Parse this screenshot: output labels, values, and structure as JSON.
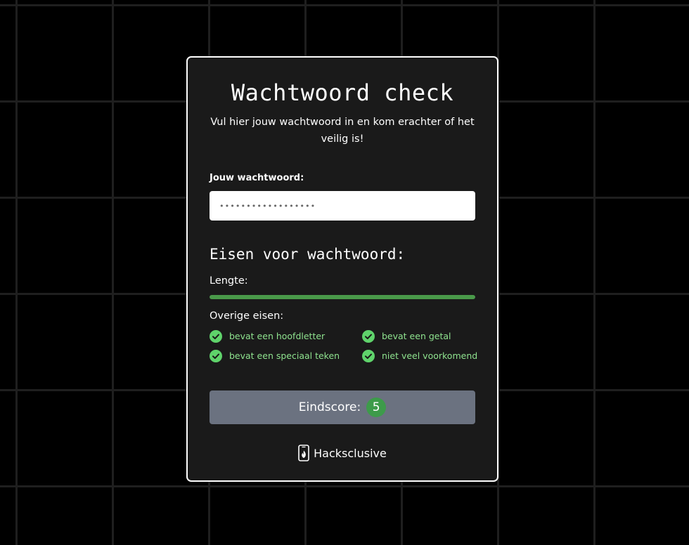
{
  "card": {
    "title": "Wachtwoord check",
    "subtitle": "Vul hier jouw wachtwoord in en kom erachter of het veilig is!"
  },
  "password": {
    "label": "Jouw wachtwoord:",
    "value": "••••••••••••••••••"
  },
  "requirements": {
    "title": "Eisen voor wachtwoord:",
    "length_label": "Lengte:",
    "length_progress": 1.0,
    "other_label": "Overige eisen:",
    "checks": [
      {
        "label": "bevat een hoofdletter",
        "met": true
      },
      {
        "label": "bevat een getal",
        "met": true
      },
      {
        "label": "bevat een speciaal teken",
        "met": true
      },
      {
        "label": "niet veel voorkomend",
        "met": true
      }
    ]
  },
  "score": {
    "label": "Eindscore:",
    "value": "5"
  },
  "footer": {
    "brand": "Hacksclusive",
    "icon": "phone-flame-icon"
  },
  "colors": {
    "background": "#000000",
    "grid": "#1f1f1f",
    "card": "#1a1a1a",
    "card_border": "#ffffff",
    "progress": "#4a9a4a",
    "check_green": "#5fd36b",
    "check_text": "#8fe38f",
    "button": "#6b7280",
    "score_badge": "#3d9b4a"
  }
}
